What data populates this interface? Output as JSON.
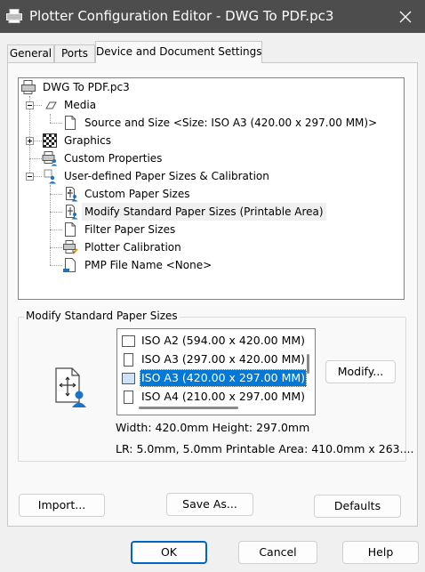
{
  "window": {
    "title": "Plotter Configuration Editor - DWG To PDF.pc3",
    "icon": "plotter-icon",
    "close_icon": "close-icon"
  },
  "tabs": [
    {
      "label": "General",
      "active": false
    },
    {
      "label": "Ports",
      "active": false
    },
    {
      "label": "Device and Document Settings",
      "active": true
    }
  ],
  "tree": {
    "items": [
      {
        "label": "DWG To PDF.pc3",
        "icon": "plotter-icon",
        "level": 0,
        "expander": "none"
      },
      {
        "label": "Media",
        "icon": "paper-sheet-icon",
        "level": 1,
        "expander": "minus"
      },
      {
        "label": "Source and Size <Size: ISO A3 (420.00 x 297.00 MM)>",
        "icon": "document-icon",
        "level": 2,
        "expander": "none"
      },
      {
        "label": "Graphics",
        "icon": "checkerboard-icon",
        "level": 1,
        "expander": "plus"
      },
      {
        "label": "Custom Properties",
        "icon": "printer-user-icon",
        "level": 1,
        "expander": "none"
      },
      {
        "label": "User-defined Paper Sizes & Calibration",
        "icon": "paper-user-icon",
        "level": 1,
        "expander": "minus"
      },
      {
        "label": "Custom Paper Sizes",
        "icon": "paper-size-user-icon",
        "level": 2,
        "expander": "none"
      },
      {
        "label": "Modify Standard Paper Sizes (Printable Area)",
        "icon": "paper-size-user-icon",
        "level": 2,
        "expander": "none",
        "selected": true
      },
      {
        "label": "Filter Paper Sizes",
        "icon": "document-icon",
        "level": 2,
        "expander": "none"
      },
      {
        "label": "Plotter Calibration",
        "icon": "plotter-calibration-icon",
        "level": 2,
        "expander": "none"
      },
      {
        "label": "PMP File Name <None>",
        "icon": "pmp-file-icon",
        "level": 2,
        "expander": "none"
      }
    ]
  },
  "group": {
    "label": "Modify Standard Paper Sizes",
    "big_icon": "paper-size-user-icon",
    "list": [
      {
        "label": "ISO A2 (594.00 x 420.00 MM)",
        "selected": false
      },
      {
        "label": "ISO A3 (297.00 x 420.00 MM)",
        "selected": false
      },
      {
        "label": "ISO A3 (420.00 x 297.00 MM)",
        "selected": true
      },
      {
        "label": "ISO A4 (210.00 x 297.00 MM)",
        "selected": false
      }
    ],
    "modify_label": "Modify...",
    "size_info": "Width: 420.0mm Height: 297.0mm",
    "margin_info": "LR: 5.0mm, 5.0mm  Printable Area: 410.0mm x 263...."
  },
  "panel_buttons": {
    "import": "Import...",
    "save_as": "Save As...",
    "defaults": "Defaults"
  },
  "dialog_buttons": {
    "ok": "OK",
    "cancel": "Cancel",
    "help": "Help"
  },
  "colors": {
    "titlebar": "#4d4d4d",
    "selection": "#0078d7",
    "default_button_border": "#0067c0",
    "user_icon": "#1a73c8"
  }
}
